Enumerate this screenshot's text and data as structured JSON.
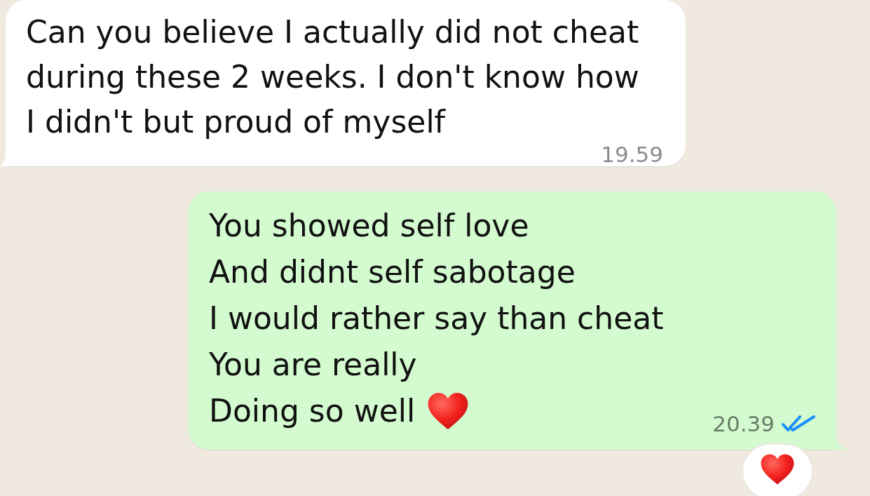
{
  "messages": [
    {
      "kind": "incoming",
      "text": "Can you believe I actually did not cheat during these 2 weeks. I don't know how I didn't but proud of myself",
      "time": "19.59"
    },
    {
      "kind": "outgoing",
      "lines": [
        {
          "kind": "plain",
          "text": "You showed self love"
        },
        {
          "kind": "plain",
          "text": "And didnt self sabotage"
        },
        {
          "kind": "plain",
          "text": "I would rather say than cheat"
        },
        {
          "kind": "plain",
          "text": "You are really"
        },
        {
          "kind": "emoji",
          "text": "Doing so well"
        }
      ],
      "time": "20.39",
      "read": true,
      "reacted": true
    }
  ]
}
